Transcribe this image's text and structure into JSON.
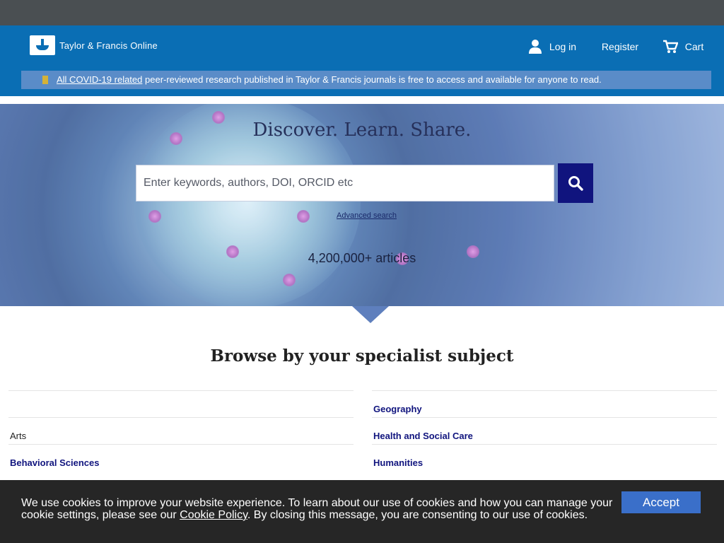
{
  "header": {
    "logo_text": "Taylor & Francis Online",
    "login_label": "Log in",
    "register_label": "Register",
    "cart_label": "Cart",
    "brand_color": "#0a6eb4"
  },
  "covid_banner": {
    "link_text": "All COVID-19 related",
    "rest_text": " peer-reviewed research published in Taylor & Francis journals is free to access and available for anyone to read."
  },
  "hero": {
    "title": "Discover. Learn. Share.",
    "search_placeholder": "Enter keywords, authors, DOI, ORCID etc",
    "advanced_search": "Advanced search",
    "article_count": "4,200,000+ articles"
  },
  "browse": {
    "title": "Browse by your specialist subject",
    "left_subjects": [
      "",
      "Arts",
      "Behavioral Sciences"
    ],
    "right_subjects": [
      "Geography",
      "Health and Social Care",
      "Humanities"
    ]
  },
  "cookie_bar": {
    "text_before": "We use cookies to improve your website experience. To learn about our use of cookies and how you can manage your cookie settings, please see our ",
    "link_text": "Cookie Policy",
    "text_after": ". By closing this message, you are consenting to our use of cookies.",
    "accept_label": "Accept"
  },
  "icons": [
    "user-icon",
    "cart-icon",
    "search-icon",
    "tf-logo-icon"
  ]
}
